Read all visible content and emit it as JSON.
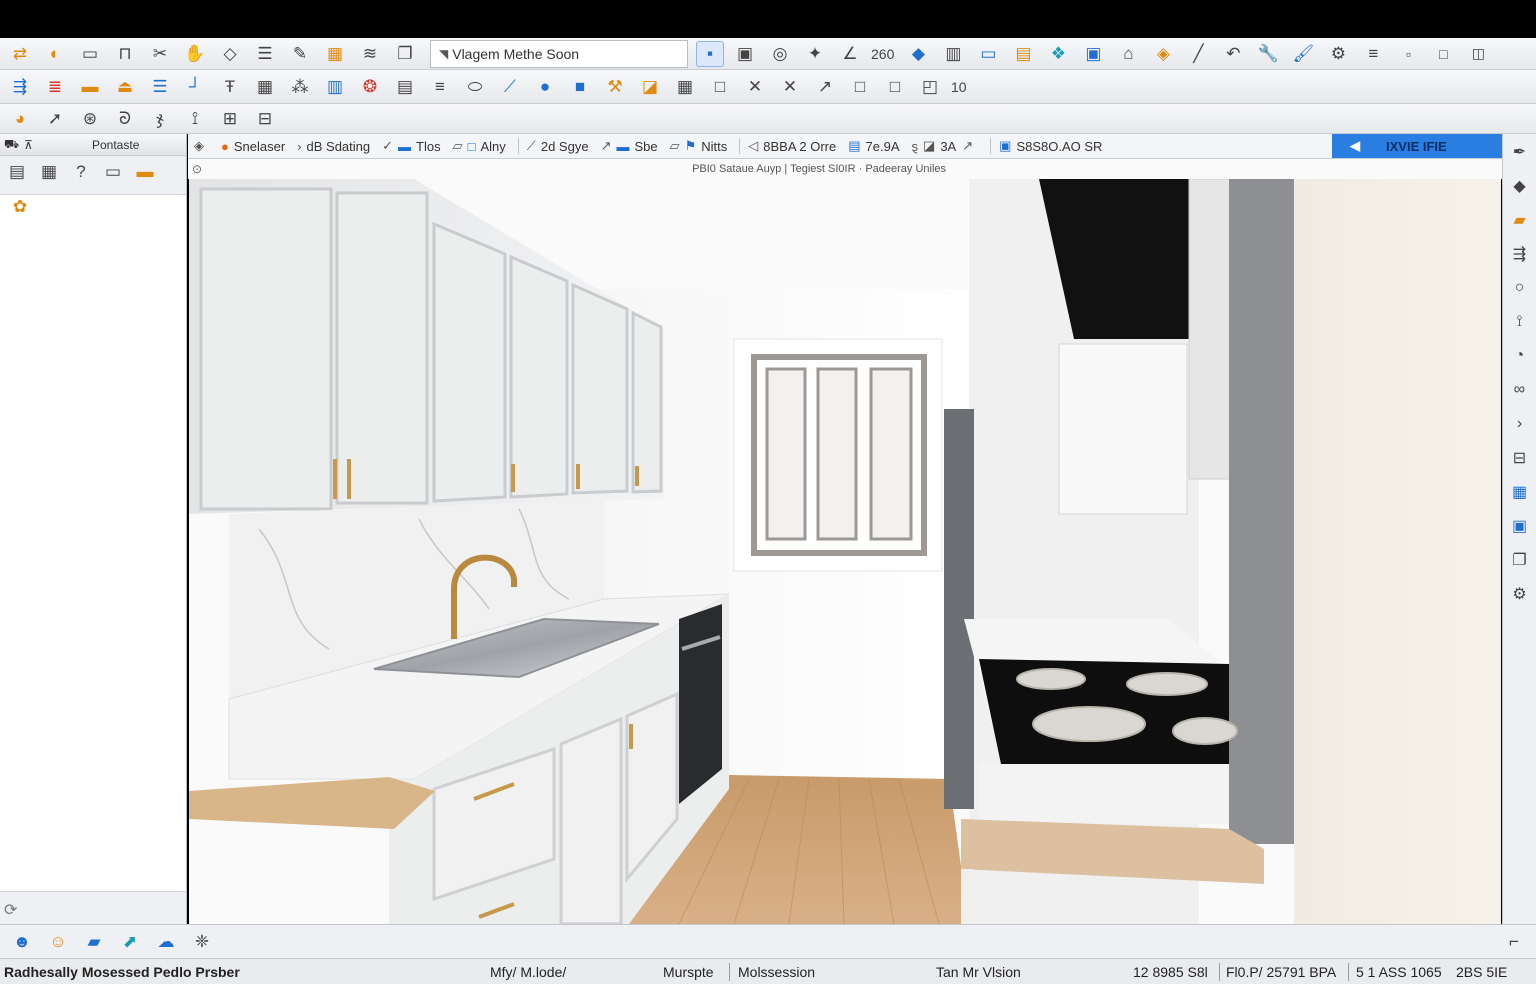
{
  "toolbar1": {
    "view_combo": "Vlagem Methe Soon",
    "zoom_value": "260"
  },
  "toolbar2": {
    "count_value": "10"
  },
  "sidebar": {
    "header_title": "Pontaste"
  },
  "filterbar": {
    "items": [
      "Snelaser",
      "dB Sdating",
      "Tlos",
      "Alny",
      "2d Sgye",
      "Sbe",
      "Nitts",
      "8BBA 2 Orre",
      "7e.9A",
      "3A",
      "S8S8O.AO SR"
    ],
    "button_label": "IXVIE IFIE"
  },
  "infobar": {
    "text": "PBI0 Sataue Auyp  |  Tegiest SI0IR  ·  Padeeray Uniles"
  },
  "statusbar": {
    "left": "Radhesally Mosessed Pedlo Prsber",
    "mode": "Mfy/ M.lode/",
    "mode2": "Murspte",
    "session": "Molssession",
    "version": "Tan Mr Vlsion",
    "coords1": "12 8985 S8l",
    "coords2": "Fl0.P/ 25791 BPA",
    "coords3": "5 1 ASS 1065",
    "coords4": "2BS 5IE"
  },
  "colors": {
    "accent": "#2a7de1",
    "titlebar": "#000000",
    "wood": "#d9b58a",
    "cabinet": "#e9eaec"
  }
}
